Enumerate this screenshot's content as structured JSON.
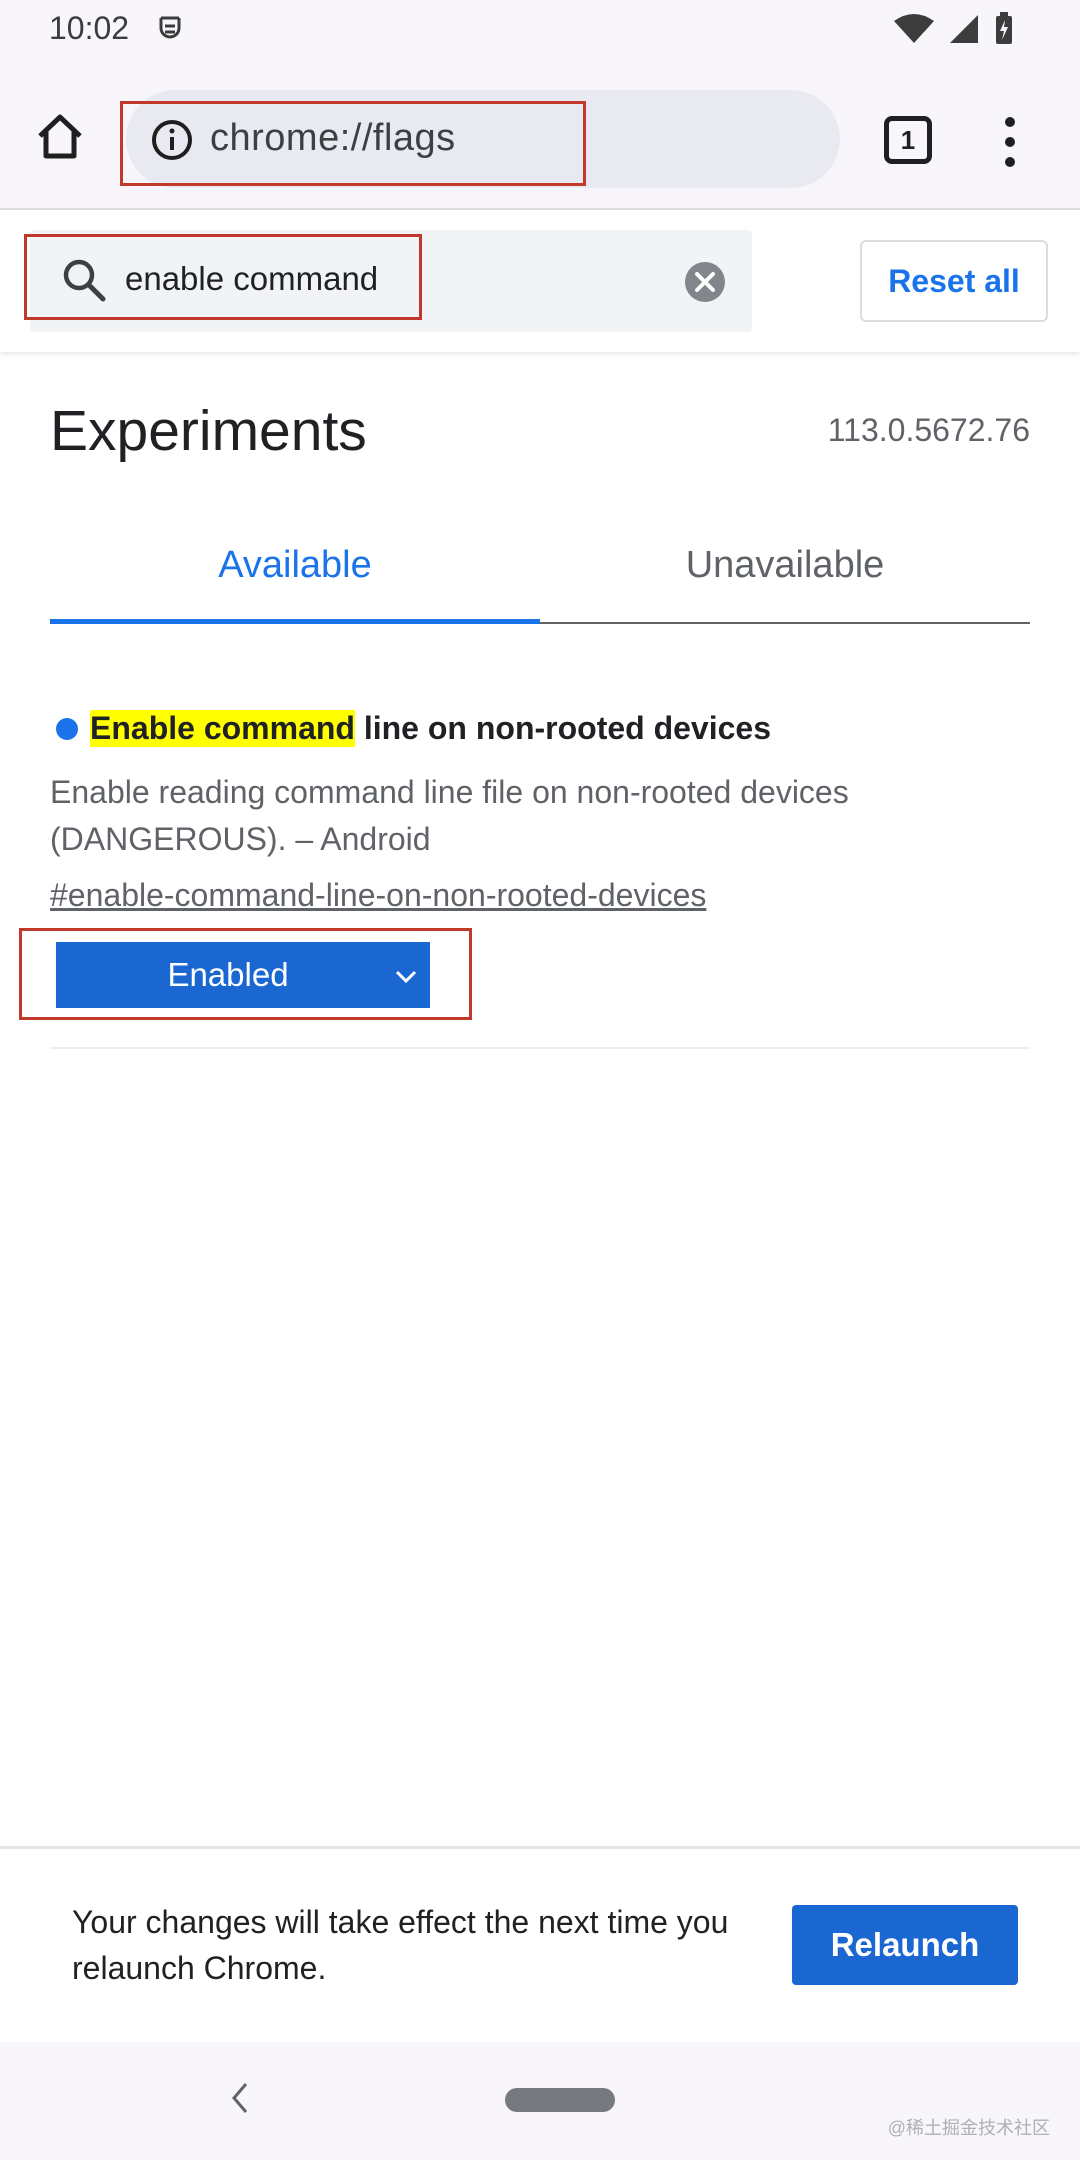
{
  "status_bar": {
    "time": "10:02"
  },
  "toolbar": {
    "url": "chrome://flags",
    "tab_count": "1"
  },
  "search": {
    "value": "enable command",
    "reset_label": "Reset all"
  },
  "header": {
    "title": "Experiments",
    "version": "113.0.5672.76"
  },
  "tabs": [
    {
      "label": "Available",
      "active": true
    },
    {
      "label": "Unavailable",
      "active": false
    }
  ],
  "experiment": {
    "title_highlight": "Enable command",
    "title_rest": " line on non-rooted devices",
    "description": "Enable reading command line file on non-rooted devices (DANGEROUS). – Android",
    "link": "#enable-command-line-on-non-rooted-devices",
    "selected": "Enabled"
  },
  "bottom": {
    "message": "Your changes will take effect the next time you relaunch Chrome.",
    "relaunch_label": "Relaunch"
  },
  "watermark": "@稀土掘金技术社区",
  "colors": {
    "accent": "#1a73e8",
    "highlight": "#ffff00",
    "annotation": "#c0392b"
  }
}
